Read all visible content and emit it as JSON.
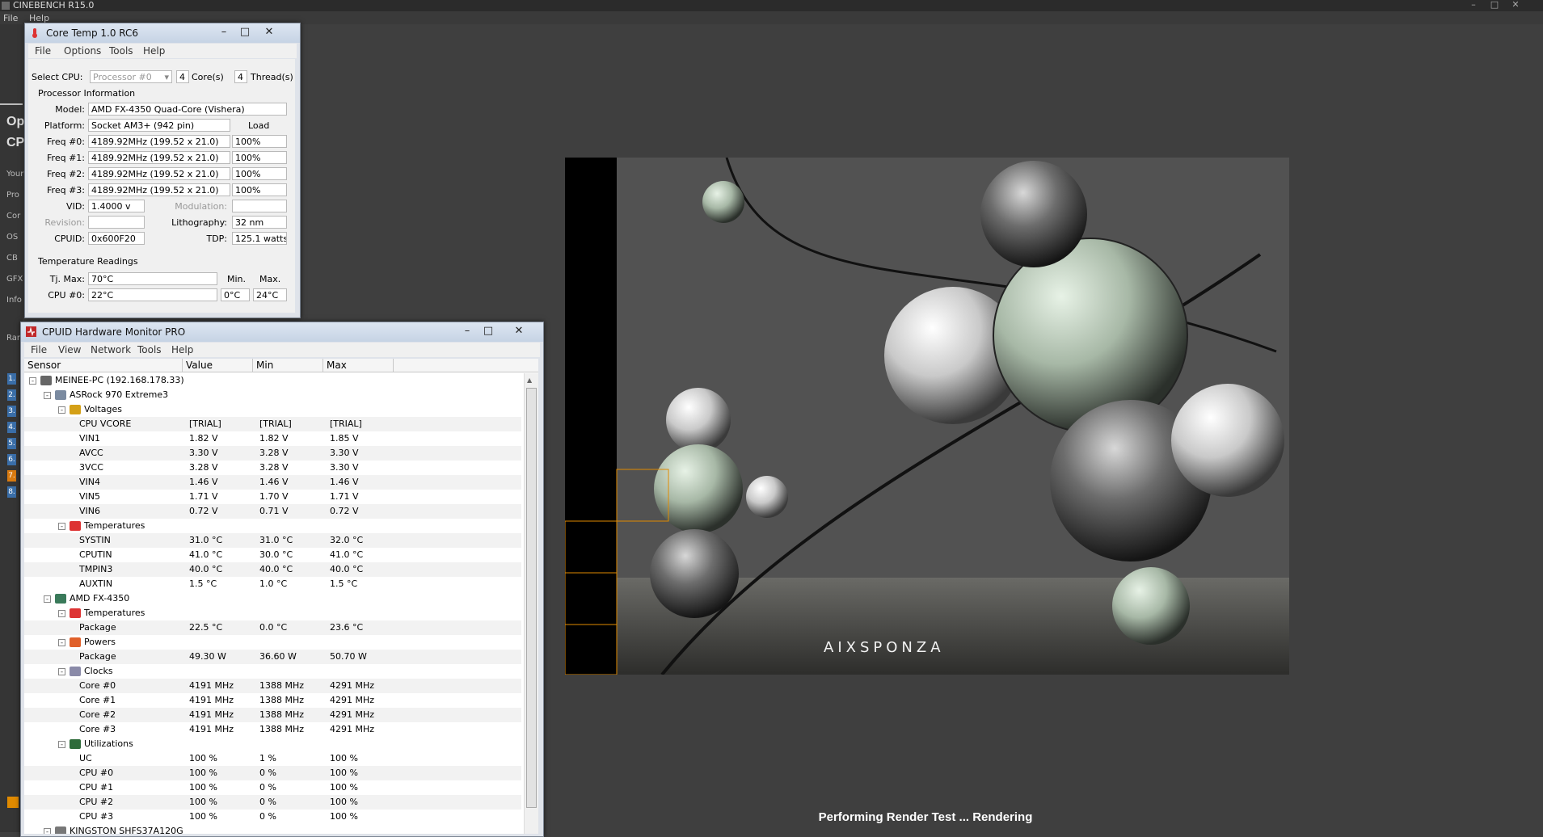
{
  "cinebench": {
    "title": "CINEBENCH R15.0",
    "menu": [
      "File",
      "Help"
    ],
    "side_big": [
      "Op",
      "CP"
    ],
    "side_small": [
      "Your",
      "Pro",
      "Cor",
      "OS",
      "CB",
      "GFX",
      "Info"
    ],
    "ranking_label": "Ran",
    "ranks": [
      "1.",
      "2.",
      "3.",
      "4.",
      "5.",
      "6.",
      "7.",
      "8."
    ],
    "status": "Performing Render Test ... Rendering",
    "render_watermark": "AIXSPONZA"
  },
  "coretemp": {
    "title": "Core Temp 1.0 RC6",
    "menu": [
      "File",
      "Options",
      "Tools",
      "Help"
    ],
    "select_cpu_label": "Select CPU:",
    "processor_select": "Processor #0",
    "cores_count": "4",
    "cores_label": "Core(s)",
    "threads_count": "4",
    "threads_label": "Thread(s)",
    "processor_info_title": "Processor Information",
    "model_label": "Model:",
    "model": "AMD FX-4350 Quad-Core (Vishera)",
    "platform_label": "Platform:",
    "platform": "Socket AM3+ (942 pin)",
    "load_label": "Load",
    "freqs": [
      {
        "label": "Freq #0:",
        "value": "4189.92MHz (199.52 x 21.0)",
        "load": "100%"
      },
      {
        "label": "Freq #1:",
        "value": "4189.92MHz (199.52 x 21.0)",
        "load": "100%"
      },
      {
        "label": "Freq #2:",
        "value": "4189.92MHz (199.52 x 21.0)",
        "load": "100%"
      },
      {
        "label": "Freq #3:",
        "value": "4189.92MHz (199.52 x 21.0)",
        "load": "100%"
      }
    ],
    "vid_label": "VID:",
    "vid": "1.4000 v",
    "modulation_label": "Modulation:",
    "revision_label": "Revision:",
    "lithography_label": "Lithography:",
    "lithography": "32 nm",
    "cpuid_label": "CPUID:",
    "cpuid": "0x600F20",
    "tdp_label": "TDP:",
    "tdp": "125.1 watts",
    "temp_title": "Temperature Readings",
    "tjmax_label": "Tj. Max:",
    "tjmax": "70°C",
    "min_label": "Min.",
    "max_label": "Max.",
    "cpu0_label": "CPU #0:",
    "cpu0": "22°C",
    "cpu0_min": "0°C",
    "cpu0_max": "24°C"
  },
  "hwmon": {
    "title": "CPUID Hardware Monitor PRO",
    "menu": [
      "File",
      "View",
      "Network",
      "Tools",
      "Help"
    ],
    "columns": [
      "Sensor",
      "Value",
      "Min",
      "Max"
    ],
    "rows": [
      {
        "level": 0,
        "toggle": "-",
        "icon": "computer-icon",
        "name": "MEINEE-PC (192.168.178.33)",
        "value": "",
        "min": "",
        "max": ""
      },
      {
        "level": 1,
        "toggle": "-",
        "icon": "motherboard-icon",
        "name": "ASRock 970 Extreme3",
        "value": "",
        "min": "",
        "max": ""
      },
      {
        "level": 2,
        "toggle": "-",
        "icon": "voltage-icon",
        "name": "Voltages",
        "value": "",
        "min": "",
        "max": ""
      },
      {
        "level": 3,
        "name": "CPU VCORE",
        "value": "[TRIAL]",
        "min": "[TRIAL]",
        "max": "[TRIAL]"
      },
      {
        "level": 3,
        "name": "VIN1",
        "value": "1.82 V",
        "min": "1.82 V",
        "max": "1.85 V"
      },
      {
        "level": 3,
        "name": "AVCC",
        "value": "3.30 V",
        "min": "3.28 V",
        "max": "3.30 V"
      },
      {
        "level": 3,
        "name": "3VCC",
        "value": "3.28 V",
        "min": "3.28 V",
        "max": "3.30 V"
      },
      {
        "level": 3,
        "name": "VIN4",
        "value": "1.46 V",
        "min": "1.46 V",
        "max": "1.46 V"
      },
      {
        "level": 3,
        "name": "VIN5",
        "value": "1.71 V",
        "min": "1.70 V",
        "max": "1.71 V"
      },
      {
        "level": 3,
        "name": "VIN6",
        "value": "0.72 V",
        "min": "0.71 V",
        "max": "0.72 V"
      },
      {
        "level": 2,
        "toggle": "-",
        "icon": "thermometer-icon",
        "name": "Temperatures",
        "value": "",
        "min": "",
        "max": ""
      },
      {
        "level": 3,
        "name": "SYSTIN",
        "value": "31.0 °C",
        "min": "31.0 °C",
        "max": "32.0 °C"
      },
      {
        "level": 3,
        "name": "CPUTIN",
        "value": "41.0 °C",
        "min": "30.0 °C",
        "max": "41.0 °C"
      },
      {
        "level": 3,
        "name": "TMPIN3",
        "value": "40.0 °C",
        "min": "40.0 °C",
        "max": "40.0 °C"
      },
      {
        "level": 3,
        "name": "AUXTIN",
        "value": "1.5 °C",
        "min": "1.0 °C",
        "max": "1.5 °C"
      },
      {
        "level": 1,
        "toggle": "-",
        "icon": "cpu-icon",
        "name": "AMD FX-4350",
        "value": "",
        "min": "",
        "max": ""
      },
      {
        "level": 2,
        "toggle": "-",
        "icon": "thermometer-icon",
        "name": "Temperatures",
        "value": "",
        "min": "",
        "max": ""
      },
      {
        "level": 3,
        "name": "Package",
        "value": "22.5 °C",
        "min": "0.0 °C",
        "max": "23.6 °C"
      },
      {
        "level": 2,
        "toggle": "-",
        "icon": "power-icon",
        "name": "Powers",
        "value": "",
        "min": "",
        "max": ""
      },
      {
        "level": 3,
        "name": "Package",
        "value": "49.30 W",
        "min": "36.60 W",
        "max": "50.70 W"
      },
      {
        "level": 2,
        "toggle": "-",
        "icon": "clock-icon",
        "name": "Clocks",
        "value": "",
        "min": "",
        "max": ""
      },
      {
        "level": 3,
        "name": "Core #0",
        "value": "4191 MHz",
        "min": "1388 MHz",
        "max": "4291 MHz"
      },
      {
        "level": 3,
        "name": "Core #1",
        "value": "4191 MHz",
        "min": "1388 MHz",
        "max": "4291 MHz"
      },
      {
        "level": 3,
        "name": "Core #2",
        "value": "4191 MHz",
        "min": "1388 MHz",
        "max": "4291 MHz"
      },
      {
        "level": 3,
        "name": "Core #3",
        "value": "4191 MHz",
        "min": "1388 MHz",
        "max": "4291 MHz"
      },
      {
        "level": 2,
        "toggle": "-",
        "icon": "utilization-icon",
        "name": "Utilizations",
        "value": "",
        "min": "",
        "max": ""
      },
      {
        "level": 3,
        "name": "UC",
        "value": "100 %",
        "min": "1 %",
        "max": "100 %"
      },
      {
        "level": 3,
        "name": "CPU #0",
        "value": "100 %",
        "min": "0 %",
        "max": "100 %"
      },
      {
        "level": 3,
        "name": "CPU #1",
        "value": "100 %",
        "min": "0 %",
        "max": "100 %"
      },
      {
        "level": 3,
        "name": "CPU #2",
        "value": "100 %",
        "min": "0 %",
        "max": "100 %"
      },
      {
        "level": 3,
        "name": "CPU #3",
        "value": "100 %",
        "min": "0 %",
        "max": "100 %"
      },
      {
        "level": 1,
        "toggle": "-",
        "icon": "drive-icon",
        "name": "KINGSTON SHFS37A120G",
        "value": "",
        "min": "",
        "max": ""
      }
    ]
  },
  "colors": {
    "bg": "#3f3f3f",
    "accent_orange": "#e08a00",
    "rank_blue": "#3a6ea8"
  }
}
